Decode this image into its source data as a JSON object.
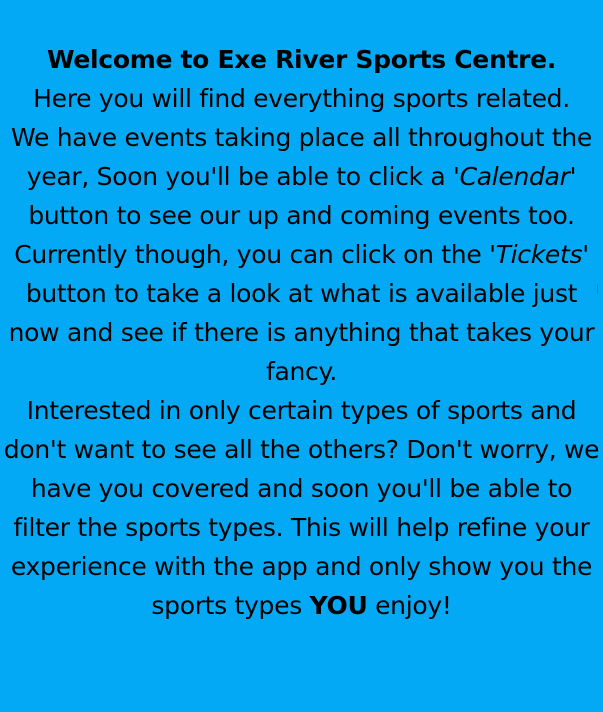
{
  "intro": {
    "title": "Welcome to Exe River Sports Centre.",
    "line": "Here you will find everything sports related."
  },
  "calendar_paragraph": {
    "before": "We have events taking place all throughout the year, Soon you'll be able to click a '",
    "link_word": "Calendar",
    "after": "' button to see our up and coming events too."
  },
  "tickets_paragraph": {
    "before": "Currently though, you can click on the '",
    "link_word": "Tickets",
    "after": "' button to take a look at what is available just now and see if there is anything that takes your fancy."
  },
  "filter_paragraph": {
    "before": "Interested in only certain types of sports and don't want to see all the others? Don't worry, we have you covered and soon you'll be able to filter the sports types. This will help refine your experience with the app and only show you the sports types ",
    "emphasis": "YOU",
    "after": " enjoy!"
  },
  "colors": {
    "background": "#03a9f4",
    "text": "#000000"
  }
}
